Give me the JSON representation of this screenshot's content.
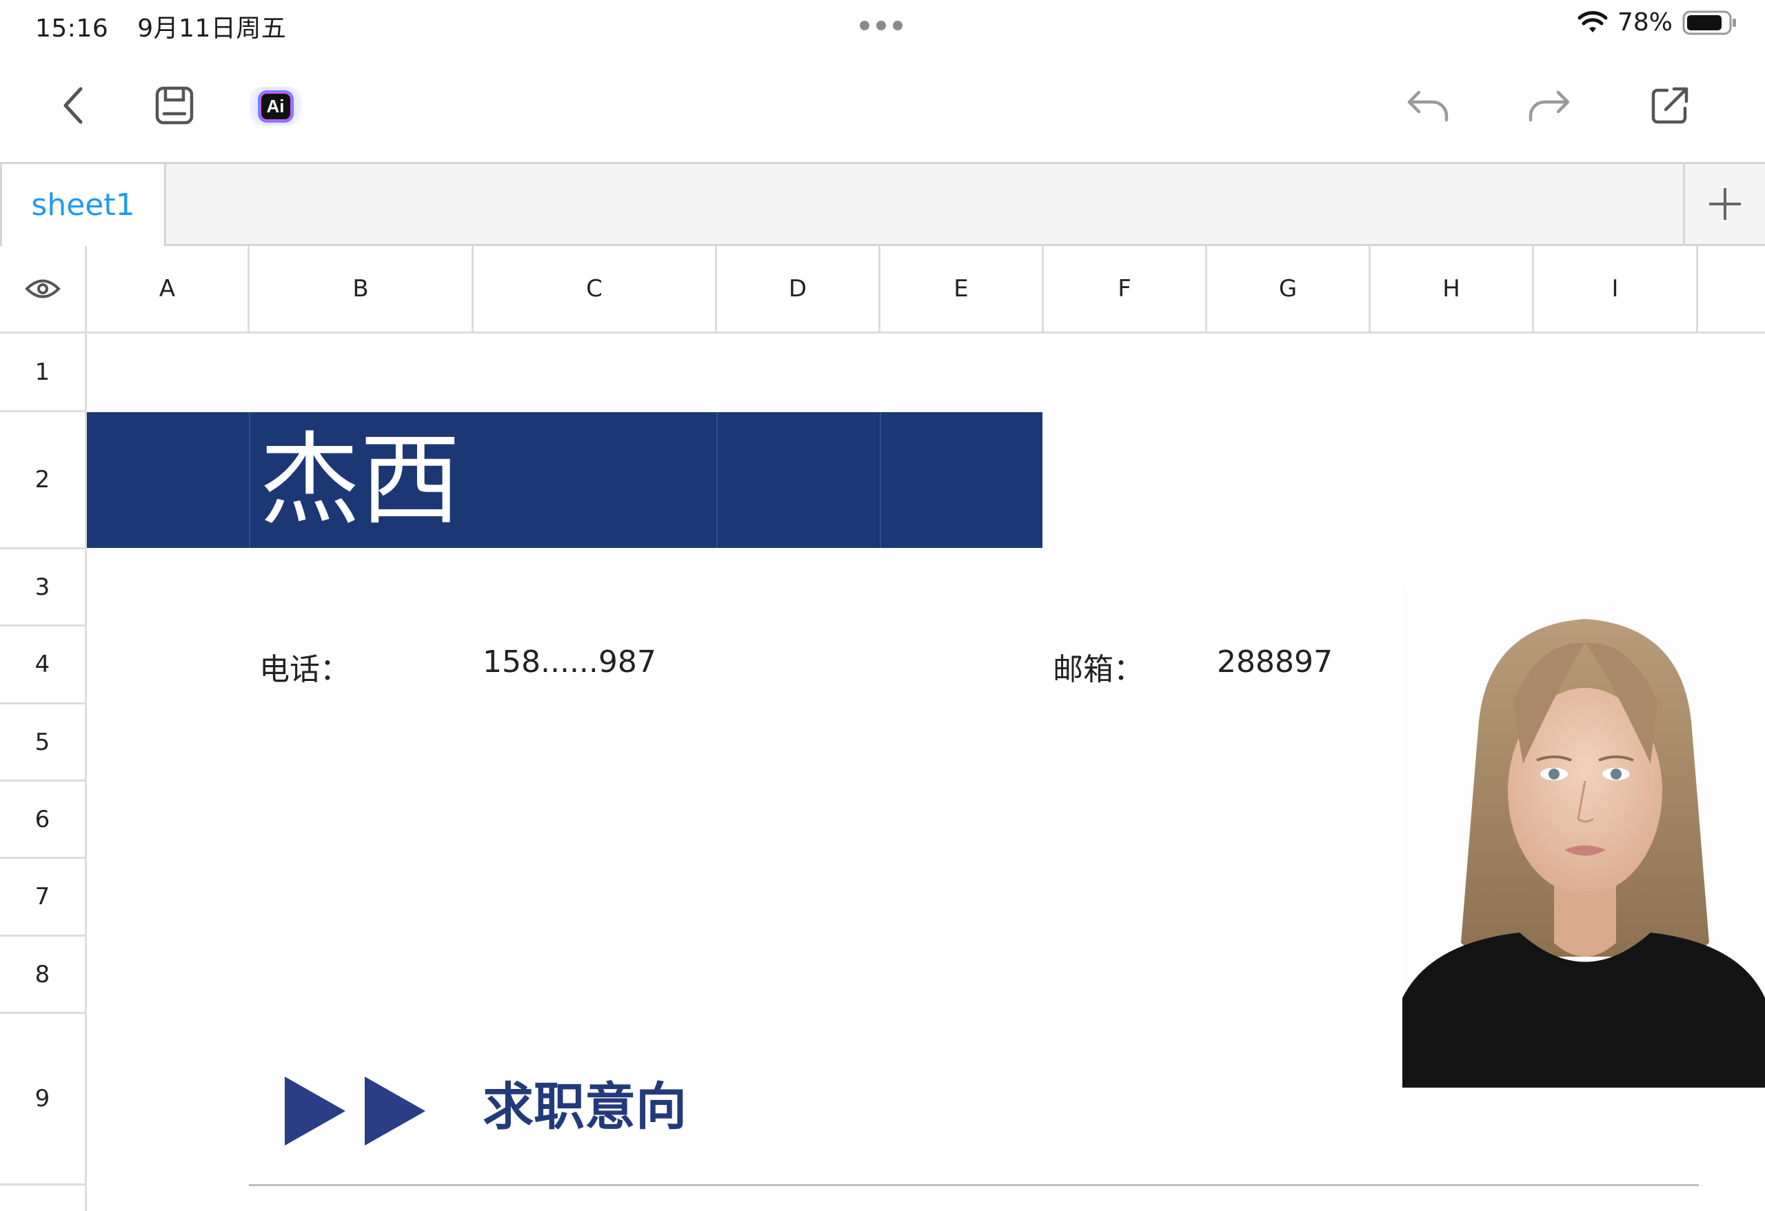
{
  "status_bar": {
    "time": "15:16",
    "date": "9月11日周五",
    "battery": "78%"
  },
  "toolbar": {
    "ai_label": "Ai"
  },
  "tabs": {
    "items": [
      {
        "label": "sheet1",
        "active": true
      }
    ]
  },
  "columns": [
    "A",
    "B",
    "C",
    "D",
    "E",
    "F",
    "G",
    "H",
    "I"
  ],
  "rows": [
    "1",
    "2",
    "3",
    "4",
    "5",
    "6",
    "7",
    "8",
    "9"
  ],
  "resume": {
    "name": "杰西",
    "phone_label": "电话：",
    "phone_value": "158......987",
    "email_label": "邮箱：",
    "email_value": "288897",
    "section_title": "求职意向"
  },
  "colors": {
    "accent": "#1c9bf0",
    "banner": "#1b3874",
    "section": "#233a7a",
    "arrow": "#2b3d86"
  },
  "icons": {
    "toolbar_left": [
      "chevron-left-icon",
      "save-icon",
      "ai-icon"
    ],
    "toolbar_right": [
      "undo-icon",
      "redo-icon",
      "share-icon"
    ],
    "tab_bar": [
      "plus-icon"
    ],
    "grid_corner": [
      "eye-icon"
    ]
  }
}
